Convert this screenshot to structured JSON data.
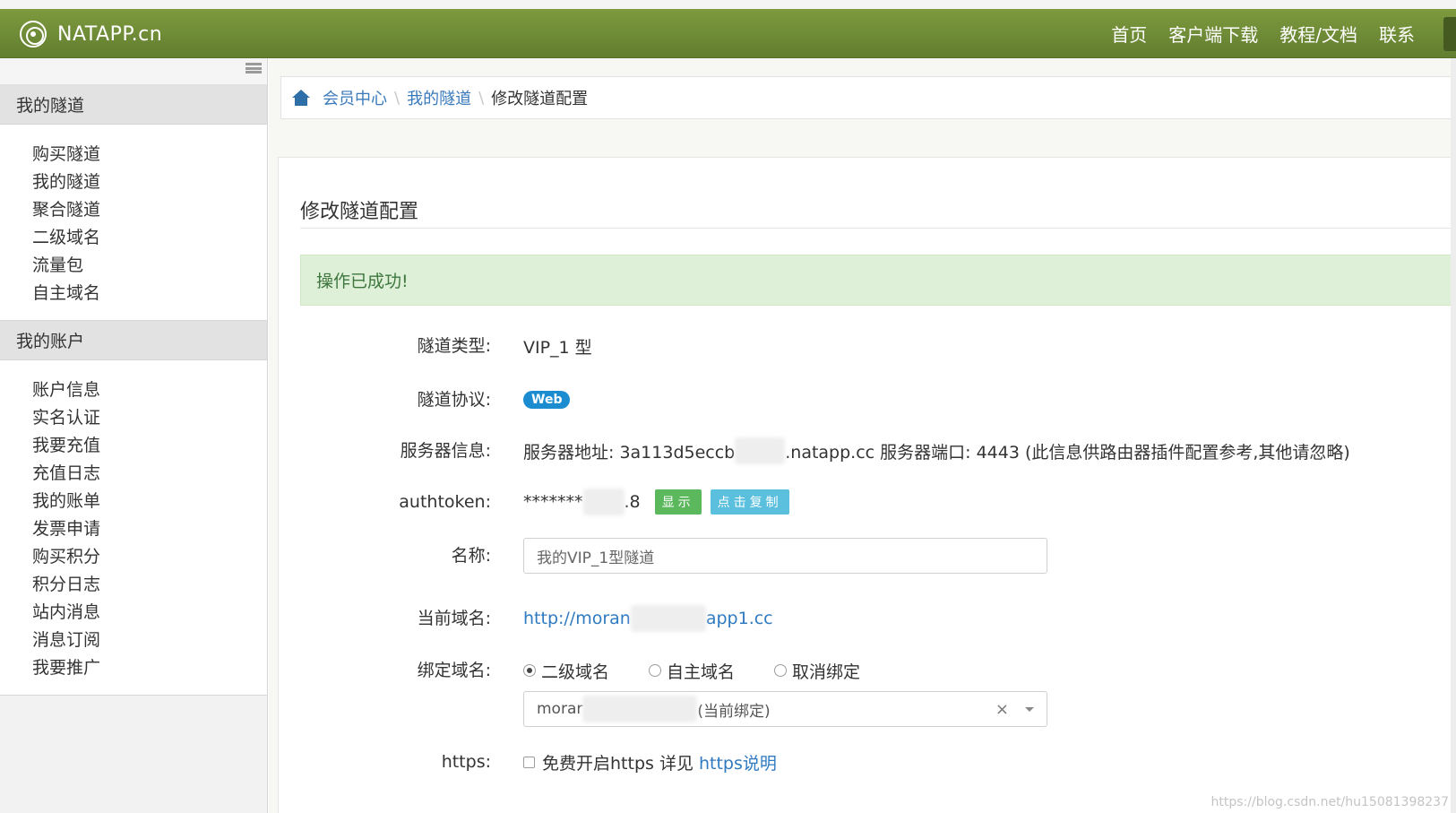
{
  "navbar": {
    "brand": "NATAPP.cn",
    "links": [
      "首页",
      "客户端下载",
      "教程/文档",
      "联系"
    ]
  },
  "sidebar": {
    "sections": [
      {
        "title": "我的隧道",
        "items": [
          "购买隧道",
          "我的隧道",
          "聚合隧道",
          "二级域名",
          "流量包",
          "自主域名"
        ]
      },
      {
        "title": "我的账户",
        "items": [
          "账户信息",
          "实名认证",
          "我要充值",
          "充值日志",
          "我的账单",
          "发票申请",
          "购买积分",
          "积分日志",
          "站内消息",
          "消息订阅",
          "我要推广"
        ]
      }
    ]
  },
  "breadcrumb": {
    "items": [
      "会员中心",
      "我的隧道"
    ],
    "current": "修改隧道配置"
  },
  "page": {
    "title": "修改隧道配置",
    "alert": "操作已成功!"
  },
  "form": {
    "type": {
      "label": "隧道类型:",
      "value": "VIP_1 型"
    },
    "protocol": {
      "label": "隧道协议:",
      "badge": "Web"
    },
    "server": {
      "label": "服务器信息:",
      "prefix": "服务器地址: 3a113d5eccb",
      "suffix": ".natapp.cc 服务器端口: 4443 (此信息供路由器插件配置参考,其他请忽略)"
    },
    "authtoken": {
      "label": "authtoken:",
      "masked": "*******",
      "tail": ".8",
      "show_button": "显示",
      "copy_button": "点击复制"
    },
    "name": {
      "label": "名称:",
      "value": "我的VIP_1型隧道"
    },
    "current_domain": {
      "label": "当前域名:",
      "prefix": "http://moran",
      "suffix": "app1.cc"
    },
    "bind_domain": {
      "label": "绑定域名:",
      "options": [
        "二级域名",
        "自主域名",
        "取消绑定"
      ],
      "selected_index": 0,
      "select_prefix": "morar",
      "select_suffix": "(当前绑定)",
      "clear": "×"
    },
    "https": {
      "label": "https:",
      "text": "免费开启https 详见",
      "link": "https说明"
    }
  },
  "watermark": "https://blog.csdn.net/hu15081398237"
}
